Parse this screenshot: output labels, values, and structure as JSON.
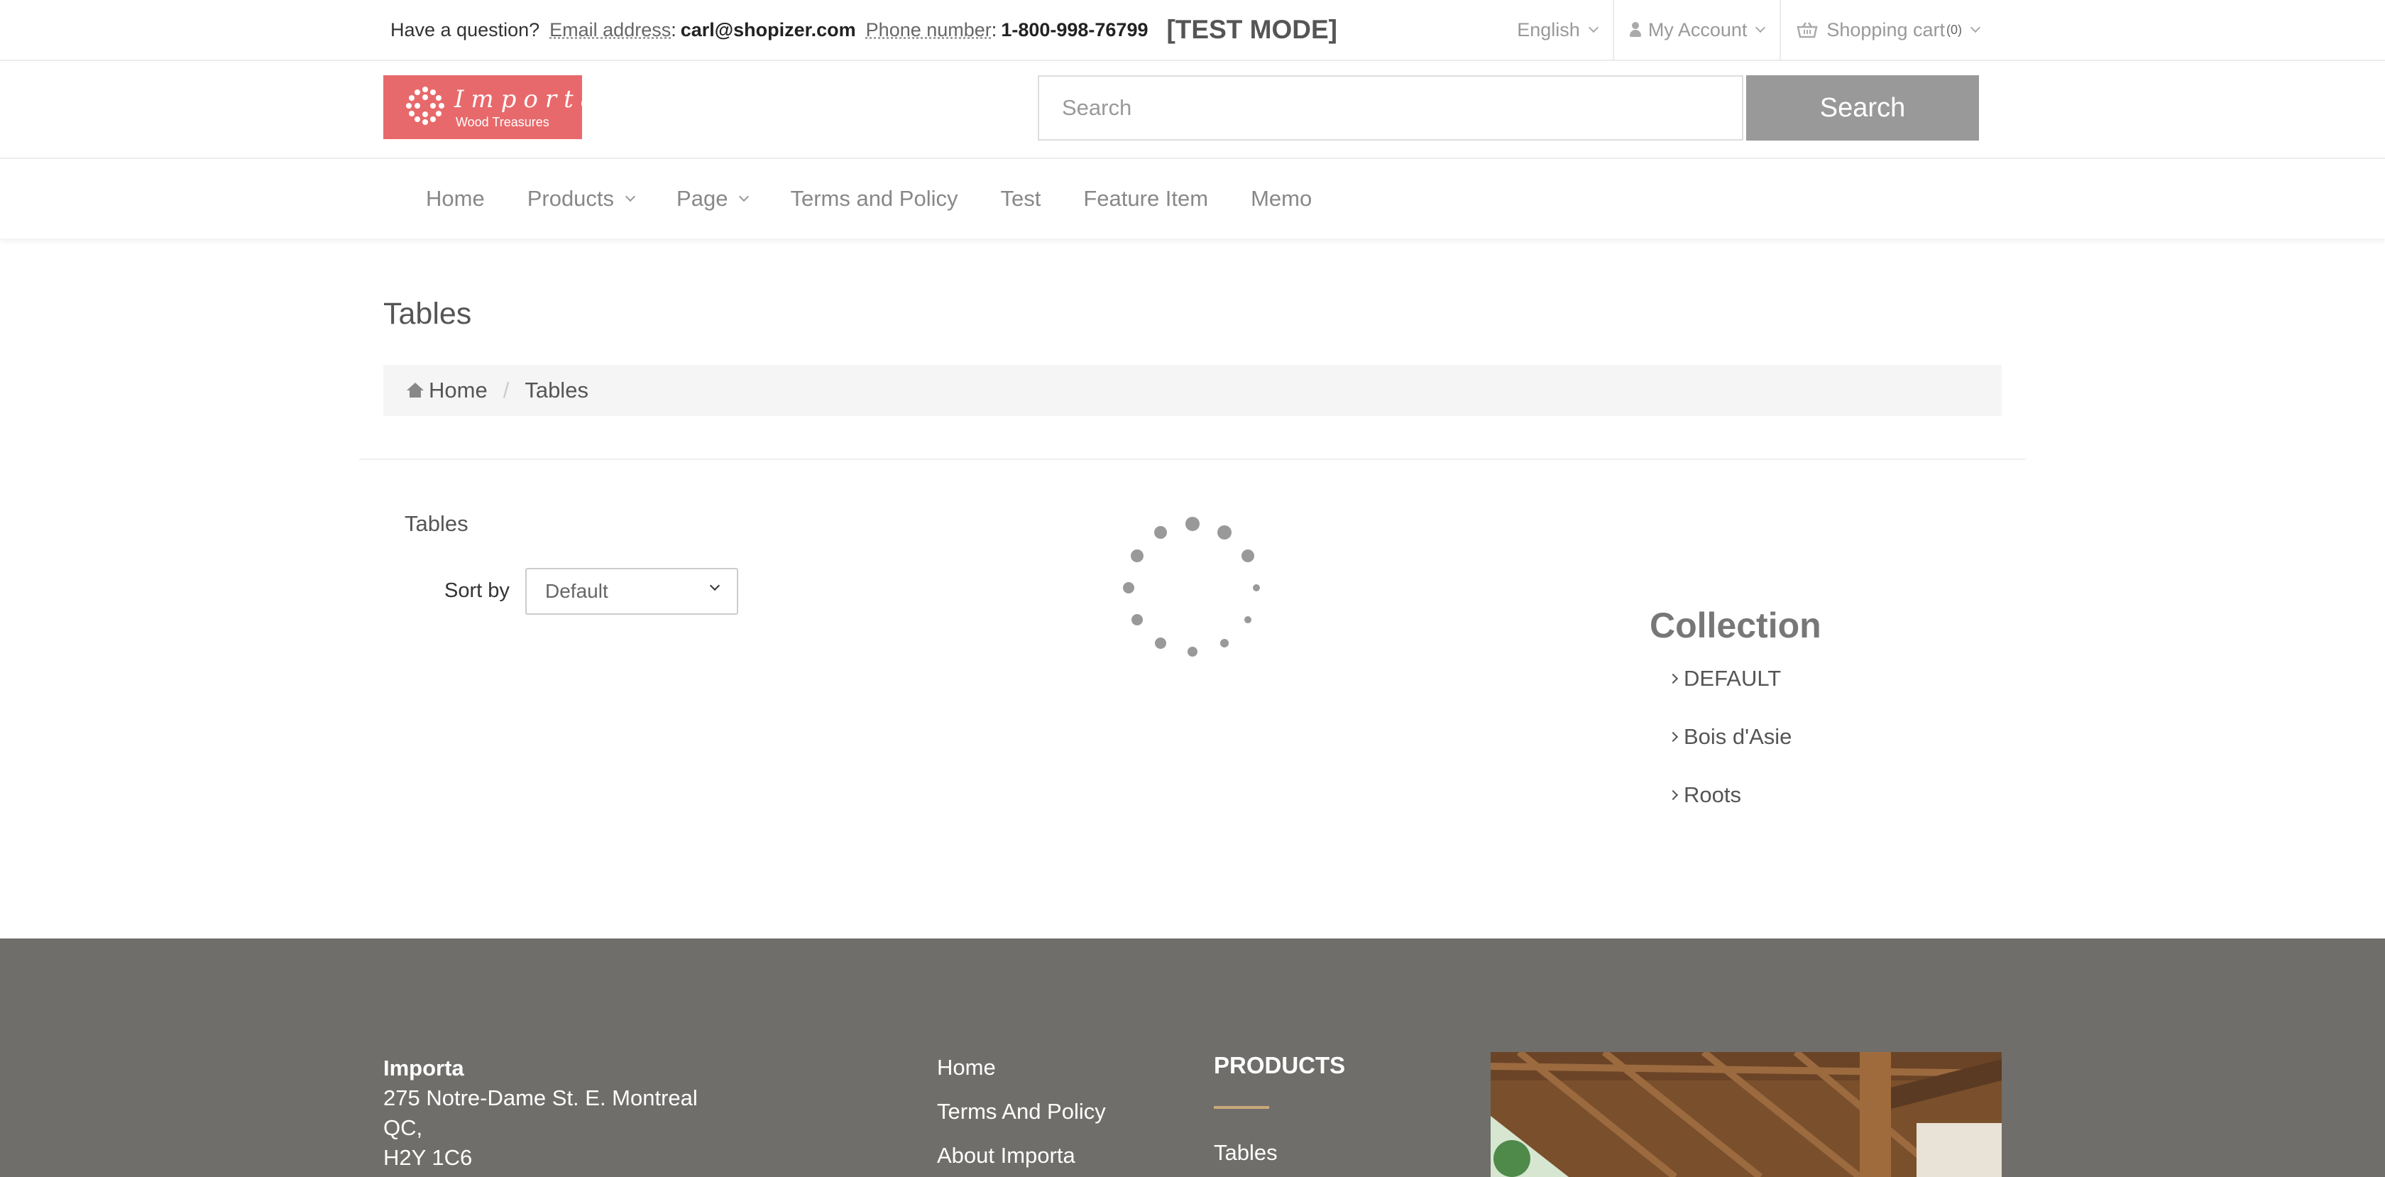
{
  "topbar": {
    "question": "Have a question?",
    "email_label": "Email address",
    "email": "carl@shopizer.com",
    "phone_label": "Phone number",
    "phone": "1-800-998-76799",
    "test_mode": "[TEST MODE]",
    "language": "English",
    "account": "My Account",
    "cart": "Shopping cart",
    "cart_count": "(0)"
  },
  "header": {
    "logo_text": "Importa",
    "logo_tagline": "Wood Treasures",
    "search_placeholder": "Search",
    "search_button": "Search"
  },
  "nav": {
    "items": [
      "Home",
      "Products",
      "Page",
      "Terms and Policy",
      "Test",
      "Feature Item",
      "Memo"
    ]
  },
  "page": {
    "title": "Tables",
    "breadcrumb_home": "Home",
    "breadcrumb_current": "Tables",
    "category_label": "Tables",
    "sort_label": "Sort by",
    "sort_value": "Default"
  },
  "collection": {
    "title": "Collection",
    "items": [
      "DEFAULT",
      "Bois d'Asie",
      "Roots"
    ]
  },
  "footer": {
    "company": "Importa",
    "address_line1": "275 Notre-Dame St. E. Montreal",
    "address_line2": "QC,",
    "address_line3": "H2Y 1C6",
    "links": [
      "Home",
      "Terms And Policy",
      "About Importa"
    ],
    "products_title": "PRODUCTS",
    "products_link": "Tables"
  },
  "icons": {
    "user": "user-icon",
    "cart": "basket-icon",
    "home": "home-icon",
    "loading": "spinner-icon"
  },
  "colors": {
    "logo_bg": "#e8696b",
    "search_button_bg": "#999999",
    "footer_bg": "#6f6e6b",
    "accent_underline": "#c9a77a"
  }
}
